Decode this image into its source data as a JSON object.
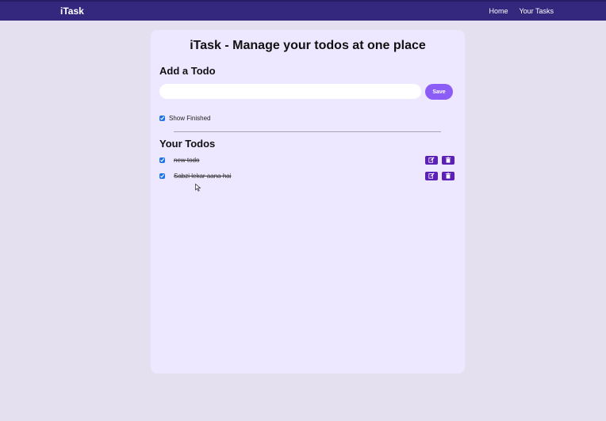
{
  "navbar": {
    "brand": "iTask",
    "links": [
      "Home",
      "Your Tasks"
    ]
  },
  "main": {
    "title": "iTask - Manage your todos at one place",
    "add_title": "Add a Todo",
    "input": {
      "value": "",
      "placeholder": ""
    },
    "save_label": "Save",
    "show_finished_label": "Show Finished",
    "show_finished_checked": true,
    "todos_title": "Your Todos",
    "todos": [
      {
        "text": "new todo",
        "completed": true
      },
      {
        "text": "Sabzi lekar aana hai",
        "completed": true
      }
    ]
  },
  "icons": {
    "edit": "edit-icon",
    "delete": "trash-icon"
  },
  "colors": {
    "navbar": "#33287e",
    "page_background": "#e4e0ef",
    "card_background": "#ede8ff",
    "save_button": "#8b5cf6",
    "action_button": "#5b21b6"
  }
}
